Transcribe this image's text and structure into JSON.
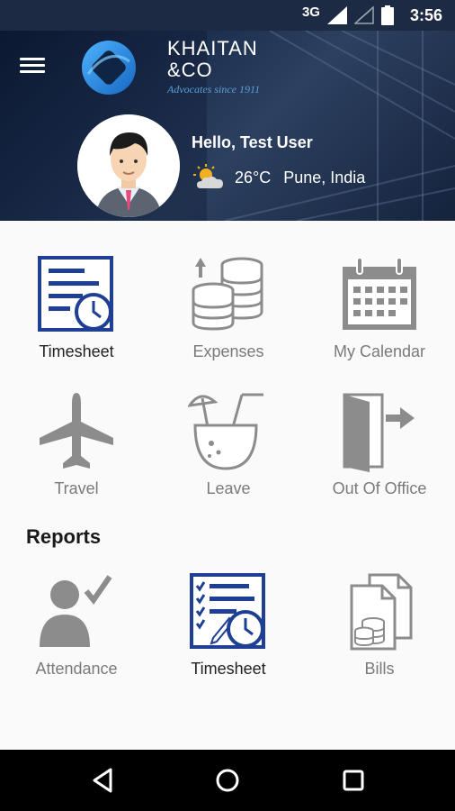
{
  "status_bar": {
    "network": "3G",
    "time": "3:56"
  },
  "header": {
    "logo_name_line1": "KHAITAN",
    "logo_name_line2": "&CO",
    "logo_tagline": "Advocates since 1911",
    "greeting": "Hello, Test User",
    "temperature": "26°C",
    "location": "Pune, India"
  },
  "tiles": [
    {
      "label": "Timesheet",
      "icon": "timesheet-icon",
      "active": true
    },
    {
      "label": "Expenses",
      "icon": "expenses-icon",
      "active": false
    },
    {
      "label": "My Calendar",
      "icon": "calendar-icon",
      "active": false
    },
    {
      "label": "Travel",
      "icon": "airplane-icon",
      "active": false
    },
    {
      "label": "Leave",
      "icon": "cocktail-icon",
      "active": false
    },
    {
      "label": "Out Of Office",
      "icon": "door-exit-icon",
      "active": false
    }
  ],
  "reports": {
    "title": "Reports",
    "items": [
      {
        "label": "Attendance",
        "icon": "attendance-icon",
        "active": false
      },
      {
        "label": "Timesheet",
        "icon": "timesheet-report-icon",
        "active": true
      },
      {
        "label": "Bills",
        "icon": "bills-icon",
        "active": false
      }
    ]
  },
  "colors": {
    "accent": "#1e3f94",
    "icon_gray": "#8c8c8c",
    "header_bg": "#1d2a44"
  }
}
